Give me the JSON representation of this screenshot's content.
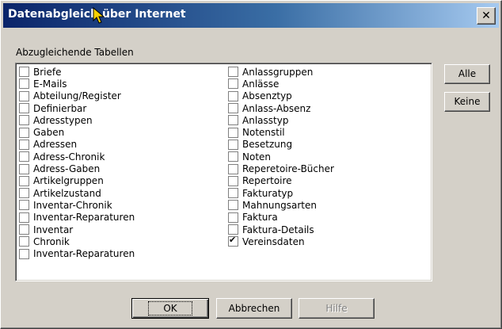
{
  "window": {
    "title": "Datenabgleich über Internet",
    "close_label": "✕"
  },
  "section_label": "Abzugleichende Tabellen",
  "tables_left": [
    {
      "label": "Briefe",
      "checked": false
    },
    {
      "label": "E-Mails",
      "checked": false
    },
    {
      "label": "Abteilung/Register",
      "checked": false
    },
    {
      "label": "Definierbar",
      "checked": false
    },
    {
      "label": "Adresstypen",
      "checked": false
    },
    {
      "label": "Gaben",
      "checked": false
    },
    {
      "label": "Adressen",
      "checked": false
    },
    {
      "label": "Adress-Chronik",
      "checked": false
    },
    {
      "label": "Adress-Gaben",
      "checked": false
    },
    {
      "label": "Artikelgruppen",
      "checked": false
    },
    {
      "label": "Artikelzustand",
      "checked": false
    },
    {
      "label": "Inventar-Chronik",
      "checked": false
    },
    {
      "label": "Inventar-Reparaturen",
      "checked": false
    },
    {
      "label": "Inventar",
      "checked": false
    },
    {
      "label": "Chronik",
      "checked": false
    },
    {
      "label": "Inventar-Reparaturen",
      "checked": false
    }
  ],
  "tables_right": [
    {
      "label": "Anlassgruppen",
      "checked": false
    },
    {
      "label": "Anlässe",
      "checked": false
    },
    {
      "label": "Absenztyp",
      "checked": false
    },
    {
      "label": "Anlass-Absenz",
      "checked": false
    },
    {
      "label": "Anlasstyp",
      "checked": false
    },
    {
      "label": "Notenstil",
      "checked": false
    },
    {
      "label": "Besetzung",
      "checked": false
    },
    {
      "label": "Noten",
      "checked": false
    },
    {
      "label": "Reperetoire-Bücher",
      "checked": false
    },
    {
      "label": "Repertoire",
      "checked": false
    },
    {
      "label": "Fakturatyp",
      "checked": false
    },
    {
      "label": "Mahnungsarten",
      "checked": false
    },
    {
      "label": "Faktura",
      "checked": false
    },
    {
      "label": "Faktura-Details",
      "checked": false
    },
    {
      "label": "Vereinsdaten",
      "checked": true
    }
  ],
  "buttons": {
    "alle": "Alle",
    "keine": "Keine",
    "ok": "OK",
    "cancel": "Abbrechen",
    "help": "Hilfe"
  },
  "colors": {
    "title_start": "#0a246a",
    "title_end": "#a6caf0",
    "face": "#d4d0c8"
  },
  "icons": {
    "cursor": "arrow-cursor-icon",
    "close": "close-icon"
  }
}
